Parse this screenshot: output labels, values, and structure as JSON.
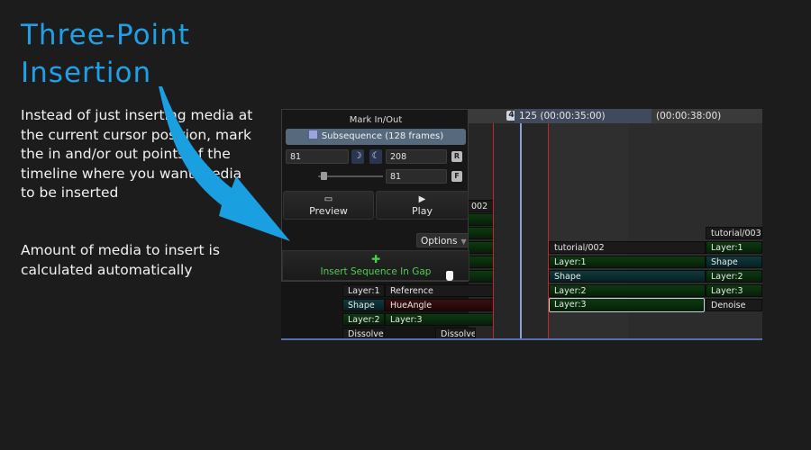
{
  "slide": {
    "title_line1": "Three-Point",
    "title_line2": "Insertion",
    "paragraph1": "Instead of just inserting media at the current cursor position, mark the in and/or out points of the timeline where you want media to be inserted",
    "paragraph2": "Amount of media to insert is calculated automatically"
  },
  "timeline": {
    "marker_number": "4",
    "timecode_current": "125 (00:00:35:00)",
    "timecode_next": "(00:00:38:00)",
    "left_label": "002"
  },
  "panel": {
    "title": "Mark In/Out",
    "subsequence": "Subsequence (128 frames)",
    "in_value": "81",
    "out_value": "208",
    "duration_value": "81",
    "r_label": "R",
    "f_label": "F",
    "moon_icon_a": "☽",
    "moon_icon_b": "☾",
    "preview_label": "Preview",
    "preview_icon": "▭",
    "play_label": "Play",
    "play_icon": "▶",
    "options_label": "Options",
    "insert_plus": "✚",
    "insert_label": "Insert Sequence In Gap"
  },
  "tracks": {
    "left_rows": [
      [
        "Layer:1",
        "Reference"
      ],
      [
        "Shape",
        "HueAngle"
      ],
      [
        "Layer:2",
        "Layer:3"
      ],
      [
        "Dissolve",
        "Dissolve"
      ]
    ],
    "gap_clips": [
      "tutorial/002",
      "Layer:1",
      "Shape",
      "Layer:2",
      "Layer:3"
    ],
    "right_clips": [
      "tutorial/003",
      "Layer:1",
      "Shape",
      "Layer:2",
      "Layer:3",
      "Denoise"
    ]
  },
  "colors": {
    "accent_title": "#1ea0e6",
    "arrow": "#1a9fe0",
    "in_out_line": "#c0272d",
    "playhead": "#8aa0d8",
    "insert_text": "#4ecf4e"
  }
}
